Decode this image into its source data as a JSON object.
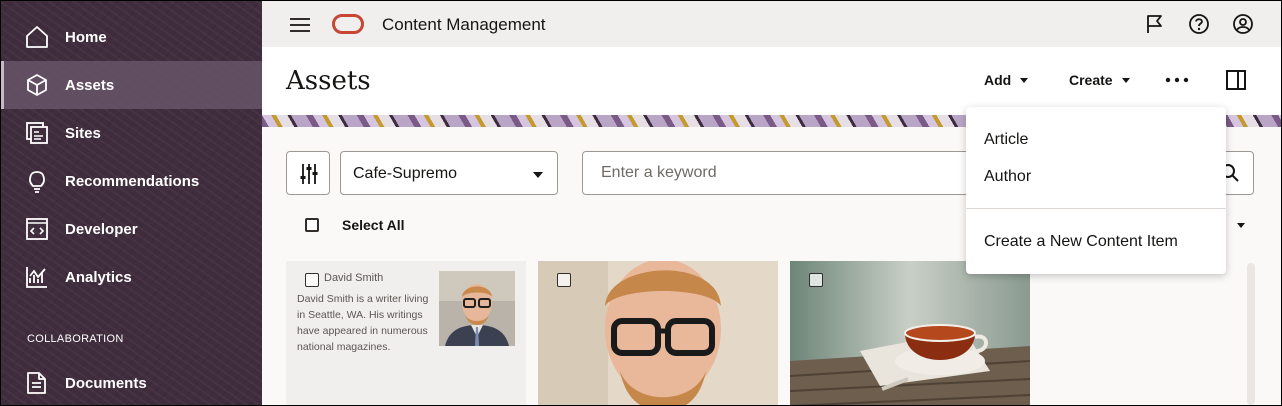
{
  "sidebar": {
    "items": [
      {
        "label": "Home",
        "icon": "home-icon"
      },
      {
        "label": "Assets",
        "icon": "cube-icon",
        "active": true
      },
      {
        "label": "Sites",
        "icon": "sites-icon"
      },
      {
        "label": "Recommendations",
        "icon": "lightbulb-icon"
      },
      {
        "label": "Developer",
        "icon": "code-window-icon"
      },
      {
        "label": "Analytics",
        "icon": "chart-icon"
      }
    ],
    "section_label": "COLLABORATION",
    "collab_items": [
      {
        "label": "Documents",
        "icon": "document-icon"
      }
    ]
  },
  "topbar": {
    "title": "Content Management",
    "icons": [
      "menu-icon",
      "oracle-logo",
      "flag-icon",
      "help-icon",
      "user-icon"
    ]
  },
  "header": {
    "title": "Assets",
    "add_label": "Add",
    "create_label": "Create",
    "more_icon": "more-icon",
    "panel_icon": "panel-icon"
  },
  "toolbar": {
    "filter_icon": "filter-icon",
    "repository": "Cafe-Supremo",
    "search_placeholder": "Enter a keyword",
    "select_all_label": "Select All"
  },
  "cards": [
    {
      "type": "content",
      "name": "David Smith",
      "description": "David Smith is a writer living in Seattle, WA. His writings have appeared in numerous national magazines."
    },
    {
      "type": "image",
      "subject": "man with glasses"
    },
    {
      "type": "image",
      "subject": "cup of tea"
    }
  ],
  "create_menu": {
    "items": [
      "Article",
      "Author"
    ],
    "footer_item": "Create a New Content Item"
  },
  "colors": {
    "sidebar_bg": "#3f2c3d",
    "oracle_red": "#c74634",
    "topbar_bg": "#f1efed"
  }
}
